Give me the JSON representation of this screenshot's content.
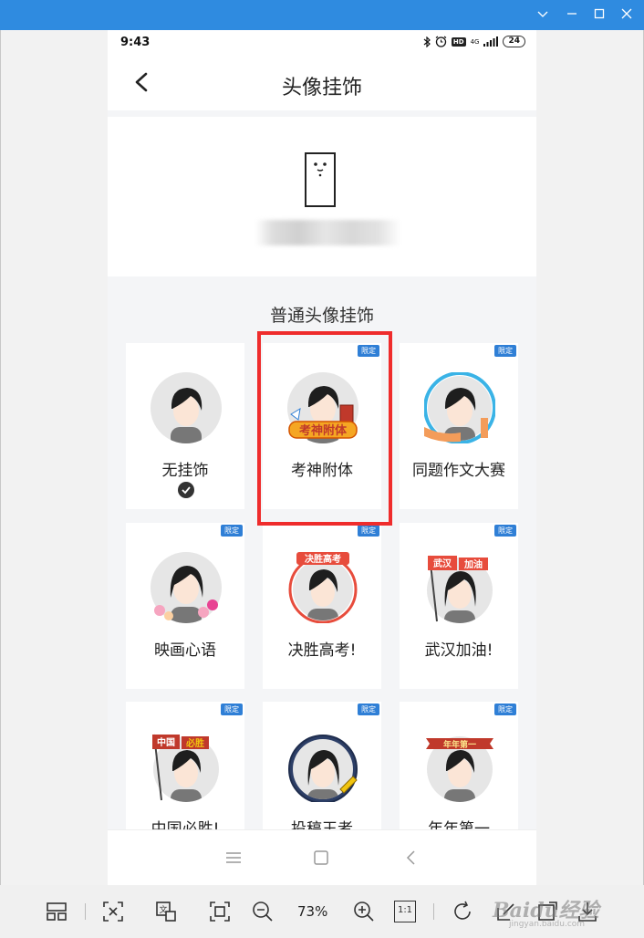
{
  "statusbar": {
    "time": "9:43",
    "battery": "24",
    "hd": "HD",
    "network": "4G"
  },
  "navbar": {
    "title": "头像挂饰"
  },
  "section": {
    "title": "普通头像挂饰"
  },
  "tag_label": "限定",
  "cards": [
    {
      "label": "无挂饰",
      "selected": true,
      "tag": false
    },
    {
      "label": "考神附体",
      "tag": true
    },
    {
      "label": "同题作文大赛",
      "tag": true
    },
    {
      "label": "映画心语",
      "tag": true
    },
    {
      "label": "决胜高考!",
      "tag": true
    },
    {
      "label": "武汉加油!",
      "tag": true
    },
    {
      "label": "中国必胜!",
      "tag": true
    },
    {
      "label": "投稿王者",
      "tag": true
    },
    {
      "label": "年年第一",
      "tag": true
    }
  ],
  "frame_text": {
    "kaoshen": "考神附体",
    "juesheng": "决胜高考",
    "wuhan_a": "武汉",
    "wuhan_b": "加油",
    "zhongguo_a": "中国",
    "zhongguo_b": "必胜",
    "niannian": "年年第一"
  },
  "toolbar": {
    "zoom": "73%",
    "actual_size": "1:1"
  },
  "watermark": {
    "brand": "Baidu经验",
    "url": "jingyan.baidu.com"
  },
  "colors": {
    "titlebar": "#2f8be0",
    "highlight": "#ef2c2c",
    "tag": "#2f7fd6"
  }
}
